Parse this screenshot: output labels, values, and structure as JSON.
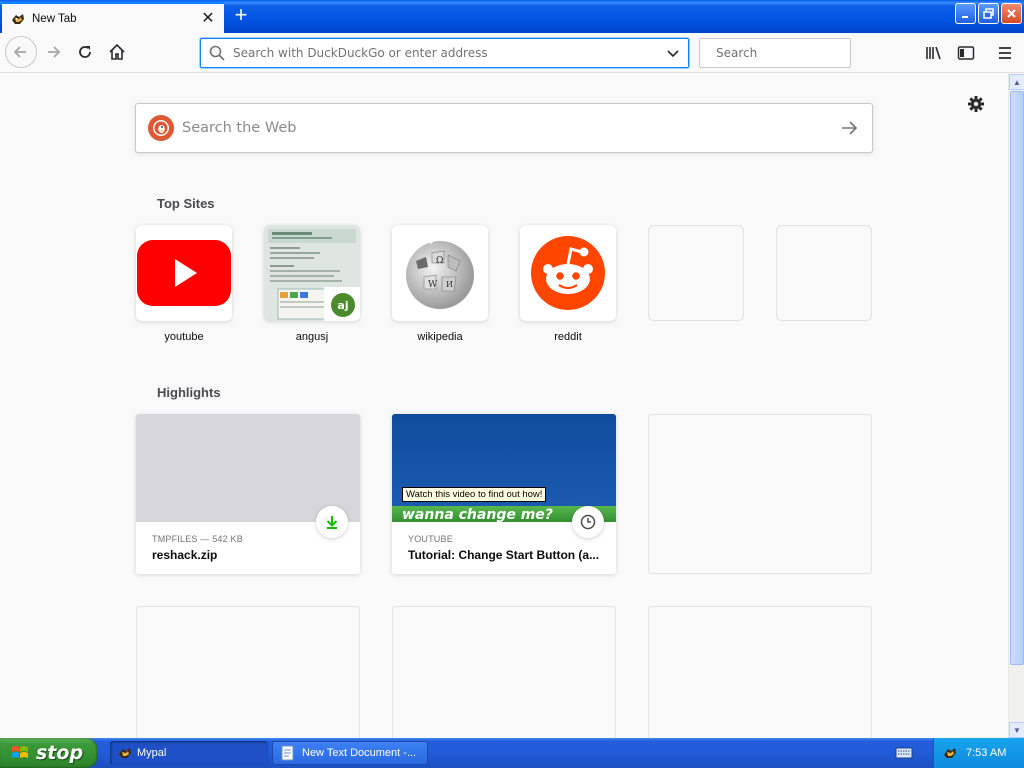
{
  "browser": {
    "tab": {
      "label": "New Tab",
      "close_symbol": "✕",
      "icon": "mypal-icon"
    },
    "new_tab_symbol": "+",
    "window_controls": {
      "minimize": "minimize-icon",
      "restore": "restore-icon",
      "close": "close-icon"
    },
    "toolbar": {
      "url_placeholder": "Search with DuckDuckGo or enter address",
      "search_placeholder": "Search"
    }
  },
  "newtab": {
    "web_search_placeholder": "Search the Web",
    "top_sites_title": "Top Sites",
    "top_sites": [
      {
        "label": "youtube",
        "icon": "youtube-logo"
      },
      {
        "label": "angusj",
        "icon": "angusj-screenshot"
      },
      {
        "label": "wikipedia",
        "icon": "wikipedia-globe"
      },
      {
        "label": "reddit",
        "icon": "reddit-logo"
      },
      {
        "label": "",
        "icon": "empty"
      },
      {
        "label": "",
        "icon": "empty"
      }
    ],
    "highlights_title": "Highlights",
    "highlights": [
      {
        "meta": "TMPFILES — 542 KB",
        "title": "reshack.zip",
        "badge": "download-icon"
      },
      {
        "meta": "YOUTUBE",
        "title": "Tutorial: Change Start Button (a...",
        "badge": "clock-icon",
        "overlay_text": "Watch this video to find out how!",
        "banner_text": "wanna change me?"
      }
    ]
  },
  "taskbar": {
    "start_label": "stop",
    "tasks": [
      {
        "label": "Mypal",
        "active": true
      },
      {
        "label": "New Text Document -...",
        "active": false
      }
    ],
    "clock": "7:53 AM"
  },
  "colors": {
    "accent": "#0a84ff",
    "taskbar": "#245edc",
    "start": "#3c9a3a",
    "youtube": "#ff0000",
    "reddit": "#ff4500",
    "download_green": "#12bc00"
  }
}
